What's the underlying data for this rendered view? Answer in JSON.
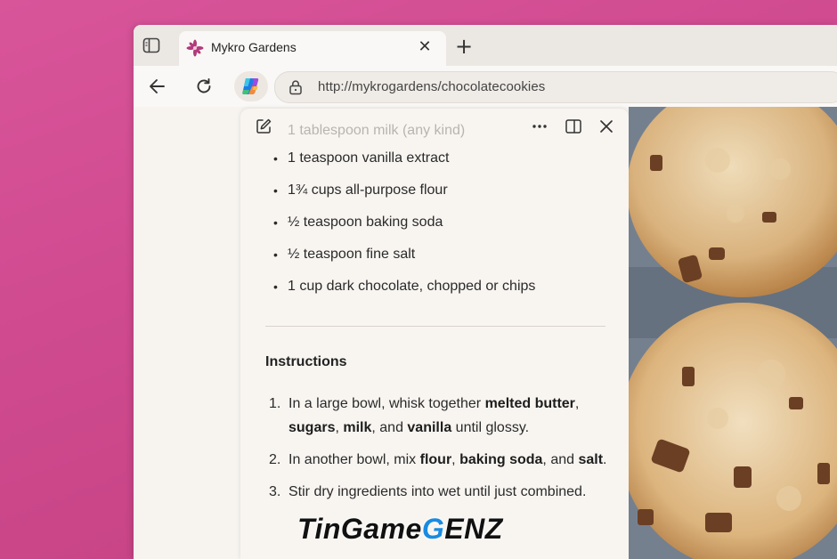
{
  "tab": {
    "title": "Mykro Gardens",
    "close": "✕"
  },
  "new_tab": "+",
  "address": {
    "url": "http://mykrogardens/chocolatecookies"
  },
  "copilot_pane": {
    "faded_item": "1 tablespoon milk (any kind)",
    "ingredients": [
      "1 teaspoon vanilla extract",
      "1¾ cups all-purpose flour",
      "½ teaspoon baking soda",
      "½ teaspoon fine salt",
      "1 cup dark chocolate, chopped or chips"
    ],
    "instructions_title": "Instructions",
    "steps": [
      {
        "num": "1.",
        "parts": [
          {
            "t": "In a large bowl, whisk together ",
            "b": false
          },
          {
            "t": "melted butter",
            "b": true
          },
          {
            "t": ", ",
            "b": false
          },
          {
            "t": "sugars",
            "b": true
          },
          {
            "t": ", ",
            "b": false
          },
          {
            "t": "milk",
            "b": true
          },
          {
            "t": ", and ",
            "b": false
          },
          {
            "t": "vanilla",
            "b": true
          },
          {
            "t": " until glossy.",
            "b": false
          }
        ]
      },
      {
        "num": "2.",
        "parts": [
          {
            "t": "In another bowl, mix ",
            "b": false
          },
          {
            "t": "flour",
            "b": true
          },
          {
            "t": ", ",
            "b": false
          },
          {
            "t": "baking soda",
            "b": true
          },
          {
            "t": ", and ",
            "b": false
          },
          {
            "t": "salt",
            "b": true
          },
          {
            "t": ".",
            "b": false
          }
        ]
      },
      {
        "num": "3.",
        "parts": [
          {
            "t": "Stir dry ingredients into wet until just combined.",
            "b": false
          }
        ]
      }
    ]
  },
  "watermark": {
    "part1": "TinGame",
    "accent": "G",
    "part2": "ENZ"
  },
  "colors": {
    "background": "#d14d92",
    "accent": "#1a8be0"
  }
}
